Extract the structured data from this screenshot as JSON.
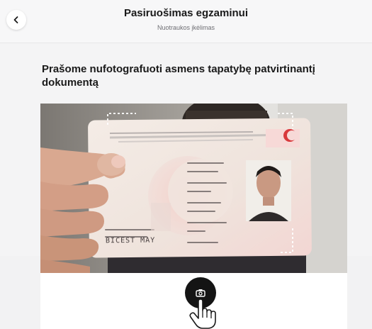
{
  "header": {
    "title": "Pasiruošimas egzaminui",
    "subtitle": "Nuotraukos įkėlimas"
  },
  "main": {
    "instruction": "Prašome nufotografuoti asmens tapatybę patvirtinantį dokumentą"
  },
  "camera": {
    "card_surname": "BICEST MAY"
  },
  "icons": {
    "back": "chevron-left-icon",
    "shutter": "camera-icon",
    "cursor": "hand-pointer-icon"
  },
  "colors": {
    "shutter": "#141414",
    "card_accent": "#d8393c"
  }
}
